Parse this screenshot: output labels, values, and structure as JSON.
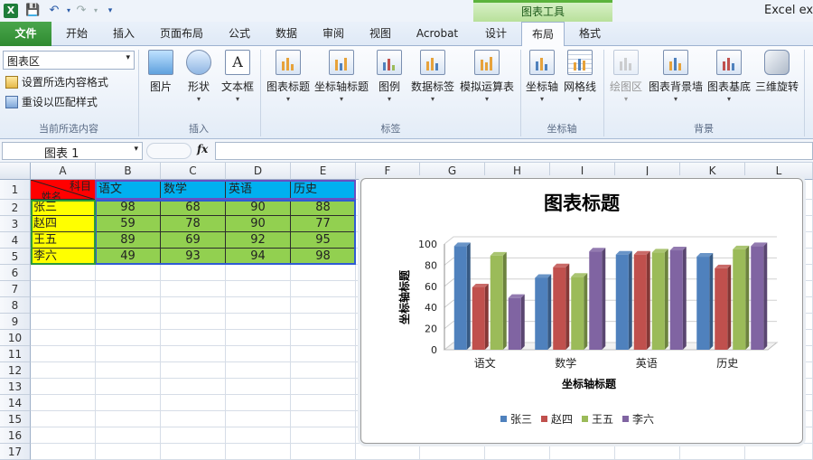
{
  "window": {
    "title_right": "Excel exp",
    "context_tab_group": "图表工具"
  },
  "quick_access": {
    "app_icon": "excel-icon",
    "save_icon": "save-icon",
    "undo_icon": "undo-icon",
    "redo_icon": "redo-icon",
    "customize_icon": "customize-qat-icon"
  },
  "tabs": [
    {
      "label": "文件",
      "active": false,
      "file": true
    },
    {
      "label": "开始"
    },
    {
      "label": "插入"
    },
    {
      "label": "页面布局"
    },
    {
      "label": "公式"
    },
    {
      "label": "数据"
    },
    {
      "label": "审阅"
    },
    {
      "label": "视图"
    },
    {
      "label": "Acrobat"
    },
    {
      "label": "设计"
    },
    {
      "label": "布局",
      "active": true
    },
    {
      "label": "格式"
    }
  ],
  "ribbon": {
    "selection_dropdown_value": "图表区",
    "format_selection_label": "设置所选内容格式",
    "reset_style_label": "重设以匹配样式",
    "groups": {
      "current_selection": "当前所选内容",
      "insert": "插入",
      "labels": "标签",
      "axes": "坐标轴",
      "background": "背景"
    },
    "buttons": {
      "picture": "图片",
      "shapes": "形状",
      "textbox": "文本框",
      "chart_title": "图表标题",
      "axis_titles": "坐标轴标题",
      "legend": "图例",
      "data_labels": "数据标签",
      "data_table": "模拟运算表",
      "axes": "坐标轴",
      "gridlines": "网格线",
      "plot_area": "绘图区",
      "chart_wall": "图表背景墙",
      "chart_floor": "图表基底",
      "rotation_3d": "三维旋转"
    }
  },
  "formula_bar": {
    "name_box": "图表 1",
    "fx": "fx",
    "value": ""
  },
  "columns": [
    "A",
    "B",
    "C",
    "D",
    "E",
    "F",
    "G",
    "H",
    "I",
    "J",
    "K",
    "L"
  ],
  "rows": [
    "1",
    "2",
    "3",
    "4",
    "5",
    "6",
    "7",
    "8",
    "9",
    "10",
    "11",
    "12",
    "13",
    "14",
    "15",
    "16",
    "17"
  ],
  "table": {
    "header_diag_top": "科目",
    "header_diag_bottom": "姓名",
    "subjects": [
      "语文",
      "数学",
      "英语",
      "历史"
    ],
    "students": [
      {
        "name": "张三",
        "scores": [
          "98",
          "68",
          "90",
          "88"
        ]
      },
      {
        "name": "赵四",
        "scores": [
          "59",
          "78",
          "90",
          "77"
        ]
      },
      {
        "name": "王五",
        "scores": [
          "89",
          "69",
          "92",
          "95"
        ]
      },
      {
        "name": "李六",
        "scores": [
          "49",
          "93",
          "94",
          "98"
        ]
      }
    ]
  },
  "colors": {
    "header_red": "#ff0000",
    "header_blue": "#00b0f0",
    "name_yellow": "#ffff00",
    "score_green": "#92d050",
    "active_tab_green": "#3a9b3c"
  },
  "chart_data": {
    "type": "bar",
    "title": "图表标题",
    "xlabel": "坐标轴标题",
    "ylabel": "坐标轴标题",
    "categories": [
      "语文",
      "数学",
      "英语",
      "历史"
    ],
    "ylim": [
      0,
      100
    ],
    "yticks": [
      "0",
      "20",
      "40",
      "60",
      "80",
      "100"
    ],
    "series": [
      {
        "name": "张三",
        "values": [
          98,
          68,
          90,
          88
        ],
        "color": "#4f81bd"
      },
      {
        "name": "赵四",
        "values": [
          59,
          78,
          90,
          77
        ],
        "color": "#c0504d"
      },
      {
        "name": "王五",
        "values": [
          89,
          69,
          92,
          95
        ],
        "color": "#9bbb59"
      },
      {
        "name": "李六",
        "values": [
          49,
          93,
          94,
          98
        ],
        "color": "#8064a2"
      }
    ],
    "legend": "bottom",
    "grid": true
  }
}
